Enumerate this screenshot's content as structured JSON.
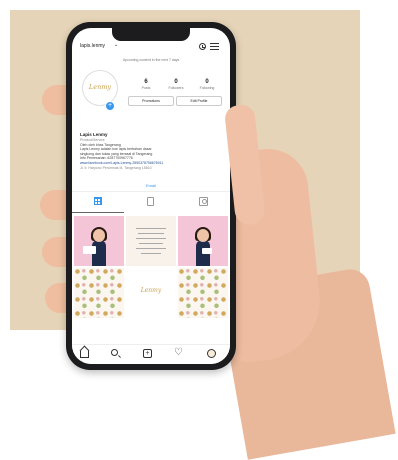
{
  "header": {
    "username": "lapis.lenmy",
    "notice": "Upcoming content in the next 7 days"
  },
  "profile": {
    "avatar_text": "Lenmy",
    "add_badge": "+",
    "stats": [
      {
        "count": "6",
        "label": "Posts"
      },
      {
        "count": "0",
        "label": "Followers"
      },
      {
        "count": "0",
        "label": "Following"
      }
    ],
    "promotions_label": "Promotions",
    "edit_profile_label": "Edit Profile"
  },
  "bio": {
    "name": "Lapis Lenmy",
    "category": "Product/Service",
    "lines": [
      "Oleh oleh khas Tangerang",
      "Lapis Lenmy adalah kue lapis berbahan dasar",
      "singkong dan tukas yang berasal di Tangerang",
      "Info Pemesanan: 6287700967776"
    ],
    "link": "www.facebook.com/Lapis-Lenmy-2550378756676911",
    "location": "Jl. Ir. Haryono Perumnas III, Tangerang 15810"
  },
  "email_label": "Email",
  "tabs": [
    {
      "icon": "grid-icon"
    },
    {
      "icon": "igtv-icon"
    },
    {
      "icon": "tagged-icon"
    }
  ],
  "posts": [
    {
      "kind": "photo"
    },
    {
      "kind": "text"
    },
    {
      "kind": "photo"
    },
    {
      "kind": "pattern"
    },
    {
      "kind": "logo",
      "text": "Lenmy"
    },
    {
      "kind": "pattern"
    }
  ],
  "nav": [
    "home-icon",
    "search-icon",
    "new-post-icon",
    "activity-icon",
    "profile-icon"
  ],
  "colors": {
    "accent": "#3897f0",
    "backdrop": "#e6d4b8",
    "brand_gold": "#c9a04c"
  }
}
